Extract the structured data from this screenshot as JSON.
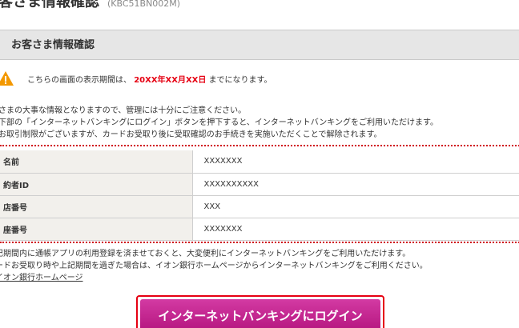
{
  "page": {
    "title": "お客さま情報確認",
    "screen_code": "(KBC51BN002M)"
  },
  "section": {
    "heading": "お客さま情報確認"
  },
  "notice": {
    "icon": "warning-icon",
    "prefix": "こちらの画面の表示期間は、",
    "date": "20XX年XX月XX日",
    "suffix": "までになります。"
  },
  "intro_lines": [
    "客さまの大事な情報となりますので、管理には十分にご注意ください。",
    "面下部の「インターネットバンキングにログイン」ボタンを押下すると、インターネットバンキングをご利用いただけます。",
    "部お取引制限がございますが、カードお受取り後に受取確認のお手続きを実施いただくことで解除されます。"
  ],
  "info_rows": [
    {
      "label": "名前",
      "value": "XXXXXXX"
    },
    {
      "label": "約者ID",
      "value": "XXXXXXXXXX"
    },
    {
      "label": "店番号",
      "value": "XXX"
    },
    {
      "label": "座番号",
      "value": "XXXXXXX"
    }
  ],
  "notes": [
    "記期間内に通帳アプリの利用登録を済ませておくと、大変便利にインターネットバンキングをご利用いただけます。",
    "ードお受取り時や上記期間を過ぎた場合は、イオン銀行ホームページからインターネットバンキングをご利用ください。"
  ],
  "homepage_link": "イオン銀行ホームページ",
  "login_button": "インターネットバンキングにログイン",
  "colors": {
    "alert_red": "#e60012",
    "button_magenta": "#c0208e",
    "header_gray": "#e6e6e6",
    "warning_orange": "#f39800"
  }
}
